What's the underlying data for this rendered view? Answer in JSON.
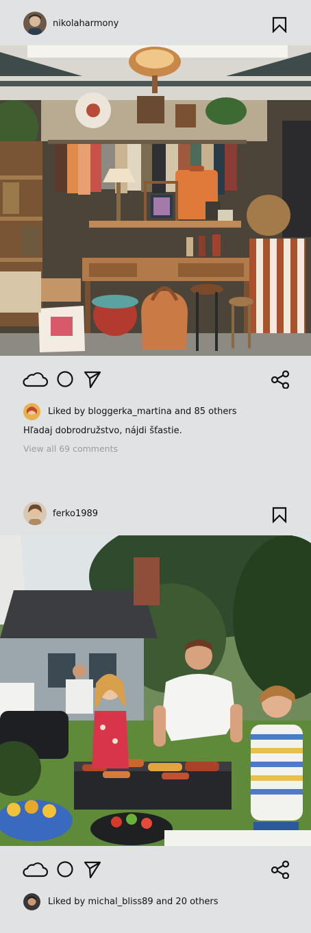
{
  "posts": [
    {
      "username": "nikolaharmony",
      "photo_alt": "",
      "likes_prefix": "Liked by ",
      "likes_user": "bloggerka_martina",
      "likes_suffix": " and 85 others",
      "caption": "Hľadaj dobrodružstvo, nájdi šťastie.",
      "view_comments": "View all 69 comments"
    },
    {
      "username": "ferko1989",
      "photo_alt": "",
      "likes_prefix": "Liked by ",
      "likes_user": "michal_bliss89",
      "likes_suffix": " and 20 others"
    }
  ],
  "icons": {
    "bookmark": "bookmark-icon",
    "like": "cloud-icon",
    "comment": "circle-icon",
    "share_send": "send-icon",
    "share": "share-icon"
  },
  "colors": {
    "background": "#e0e2e3",
    "text": "#111111",
    "muted": "#9a9c9e"
  }
}
